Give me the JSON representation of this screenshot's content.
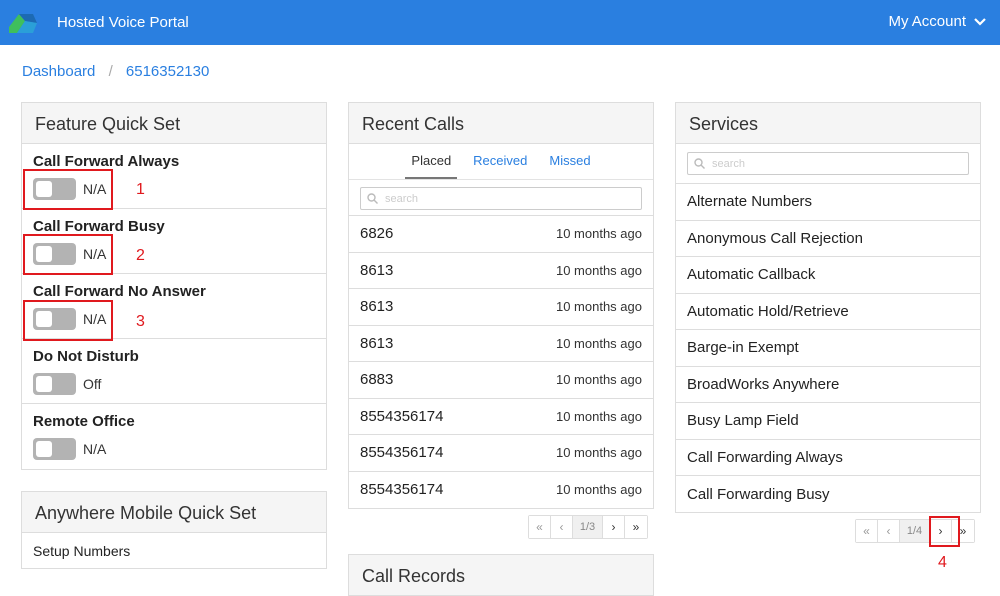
{
  "header": {
    "title": "Hosted Voice Portal",
    "account_label": "My Account",
    "brand_colors": [
      "#3fbf5c",
      "#1c6ab3"
    ]
  },
  "breadcrumb": {
    "home": "Dashboard",
    "current": "6516352130"
  },
  "feature_quick_set": {
    "title": "Feature Quick Set",
    "items": [
      {
        "label": "Call Forward Always",
        "value": "N/A",
        "annotation": "1"
      },
      {
        "label": "Call Forward Busy",
        "value": "N/A",
        "annotation": "2"
      },
      {
        "label": "Call Forward No Answer",
        "value": "N/A",
        "annotation": "3"
      },
      {
        "label": "Do Not Disturb",
        "value": "Off"
      },
      {
        "label": "Remote Office",
        "value": "N/A"
      }
    ]
  },
  "anywhere_mobile": {
    "title": "Anywhere Mobile Quick Set",
    "setup_label": "Setup Numbers"
  },
  "recent_calls": {
    "title": "Recent Calls",
    "tabs": [
      "Placed",
      "Received",
      "Missed"
    ],
    "active_tab": "Placed",
    "search_placeholder": "search",
    "calls": [
      {
        "number": "6826",
        "time": "10 months ago"
      },
      {
        "number": "8613",
        "time": "10 months ago"
      },
      {
        "number": "8613",
        "time": "10 months ago"
      },
      {
        "number": "8613",
        "time": "10 months ago"
      },
      {
        "number": "6883",
        "time": "10 months ago"
      },
      {
        "number": "8554356174",
        "time": "10 months ago"
      },
      {
        "number": "8554356174",
        "time": "10 months ago"
      },
      {
        "number": "8554356174",
        "time": "10 months ago"
      }
    ],
    "pager": {
      "first": "«",
      "prev": "‹",
      "info": "1/3",
      "next": "›",
      "last": "»"
    }
  },
  "call_records": {
    "title": "Call Records"
  },
  "services": {
    "title": "Services",
    "search_placeholder": "search",
    "items": [
      "Alternate Numbers",
      "Anonymous Call Rejection",
      "Automatic Callback",
      "Automatic Hold/Retrieve",
      "Barge-in Exempt",
      "BroadWorks Anywhere",
      "Busy Lamp Field",
      "Call Forwarding Always",
      "Call Forwarding Busy"
    ],
    "pager": {
      "first": "«",
      "prev": "‹",
      "info": "1/4",
      "next": "›",
      "last": "»",
      "annotation": "4"
    }
  },
  "colors": {
    "accent": "#2a7fe0",
    "annotation_red": "#e0191e"
  }
}
